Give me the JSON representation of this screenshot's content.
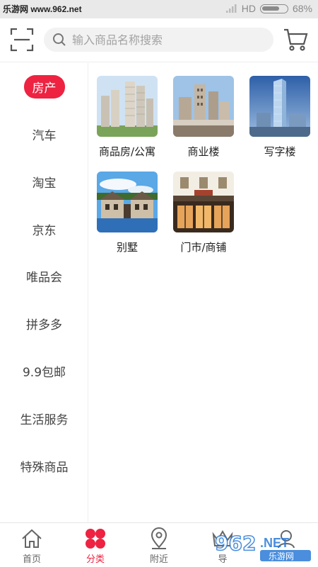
{
  "status_bar": {
    "watermark": "乐游网 www.962.net",
    "network": "HD",
    "battery": "68%",
    "battery_level": 0.68
  },
  "header": {
    "search_placeholder": "输入商品名称搜索"
  },
  "sidebar": {
    "items": [
      {
        "label": "房产",
        "active": true
      },
      {
        "label": "汽车"
      },
      {
        "label": "淘宝"
      },
      {
        "label": "京东"
      },
      {
        "label": "唯品会"
      },
      {
        "label": "拼多多"
      },
      {
        "label": "9.9包邮"
      },
      {
        "label": "生活服务"
      },
      {
        "label": "特殊商品"
      }
    ]
  },
  "content": {
    "tiles": [
      {
        "label": "商品房/公寓"
      },
      {
        "label": "商业楼"
      },
      {
        "label": "写字楼"
      },
      {
        "label": "别墅"
      },
      {
        "label": "门市/商铺"
      }
    ]
  },
  "bottom_nav": {
    "items": [
      {
        "label": "首页",
        "icon": "home-icon"
      },
      {
        "label": "分类",
        "icon": "category-icon",
        "active": true
      },
      {
        "label": "附近",
        "icon": "location-icon"
      },
      {
        "label": "导",
        "icon": "crown-icon"
      },
      {
        "label": "",
        "icon": "user-icon"
      }
    ]
  },
  "watermark_bottom": {
    "text_top": "962",
    "text_suffix": ".NET",
    "text_bottom": "乐游网"
  },
  "colors": {
    "accent": "#ee2241",
    "text": "#444444"
  }
}
